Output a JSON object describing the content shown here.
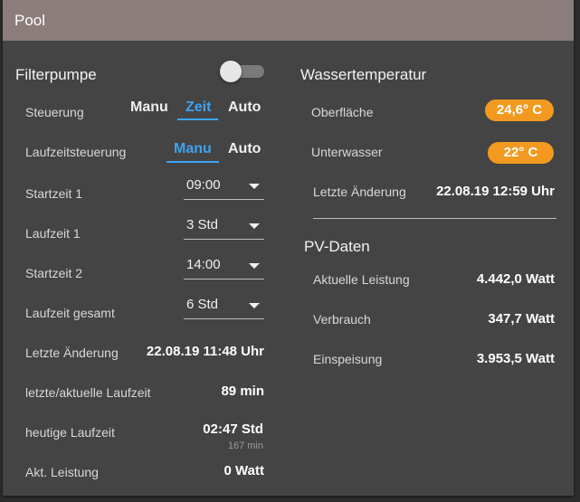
{
  "header": {
    "title": "Pool"
  },
  "filter": {
    "title": "Filterpumpe",
    "toggle_on": false,
    "steuerung": {
      "label": "Steuerung",
      "options": [
        "Manu",
        "Zeit",
        "Auto"
      ],
      "selected": "Zeit"
    },
    "laufzeitsteuerung": {
      "label": "Laufzeitsteuerung",
      "options": [
        "Manu",
        "Auto"
      ],
      "selected": "Manu"
    },
    "startzeit1": {
      "label": "Startzeit 1",
      "value": "09:00"
    },
    "laufzeit1": {
      "label": "Laufzeit 1",
      "value": "3 Std"
    },
    "startzeit2": {
      "label": "Startzeit 2",
      "value": "14:00"
    },
    "laufzeit_gesamt": {
      "label": "Laufzeit gesamt",
      "value": "6 Std"
    },
    "letzte_aenderung": {
      "label": "Letzte Änderung",
      "value": "22.08.19 11:48 Uhr"
    },
    "aktuelle_laufzeit": {
      "label": "letzte/aktuelle Laufzeit",
      "value": "89 min"
    },
    "heutige_laufzeit": {
      "label": "heutige Laufzeit",
      "value": "02:47 Std",
      "sub": "167 min"
    },
    "akt_leistung": {
      "label": "Akt. Leistung",
      "value": "0 Watt"
    }
  },
  "wasser": {
    "title": "Wassertemperatur",
    "oberflaeche": {
      "label": "Oberfläche",
      "value": "24,6° C"
    },
    "unterwasser": {
      "label": "Unterwasser",
      "value": "22° C"
    },
    "letzte_aenderung": {
      "label": "Letzte Änderung",
      "value": "22.08.19 12:59 Uhr"
    }
  },
  "pv": {
    "title": "PV-Daten",
    "aktuelle_leistung": {
      "label": "Aktuelle Leistung",
      "value": "4.442,0 Watt"
    },
    "verbrauch": {
      "label": "Verbrauch",
      "value": "347,7 Watt"
    },
    "einspeisung": {
      "label": "Einspeisung",
      "value": "3.953,5 Watt"
    }
  },
  "colors": {
    "accent": "#3ea3f2",
    "badge": "#f29a1f",
    "header": "#8a7d7b",
    "card": "#444444"
  }
}
